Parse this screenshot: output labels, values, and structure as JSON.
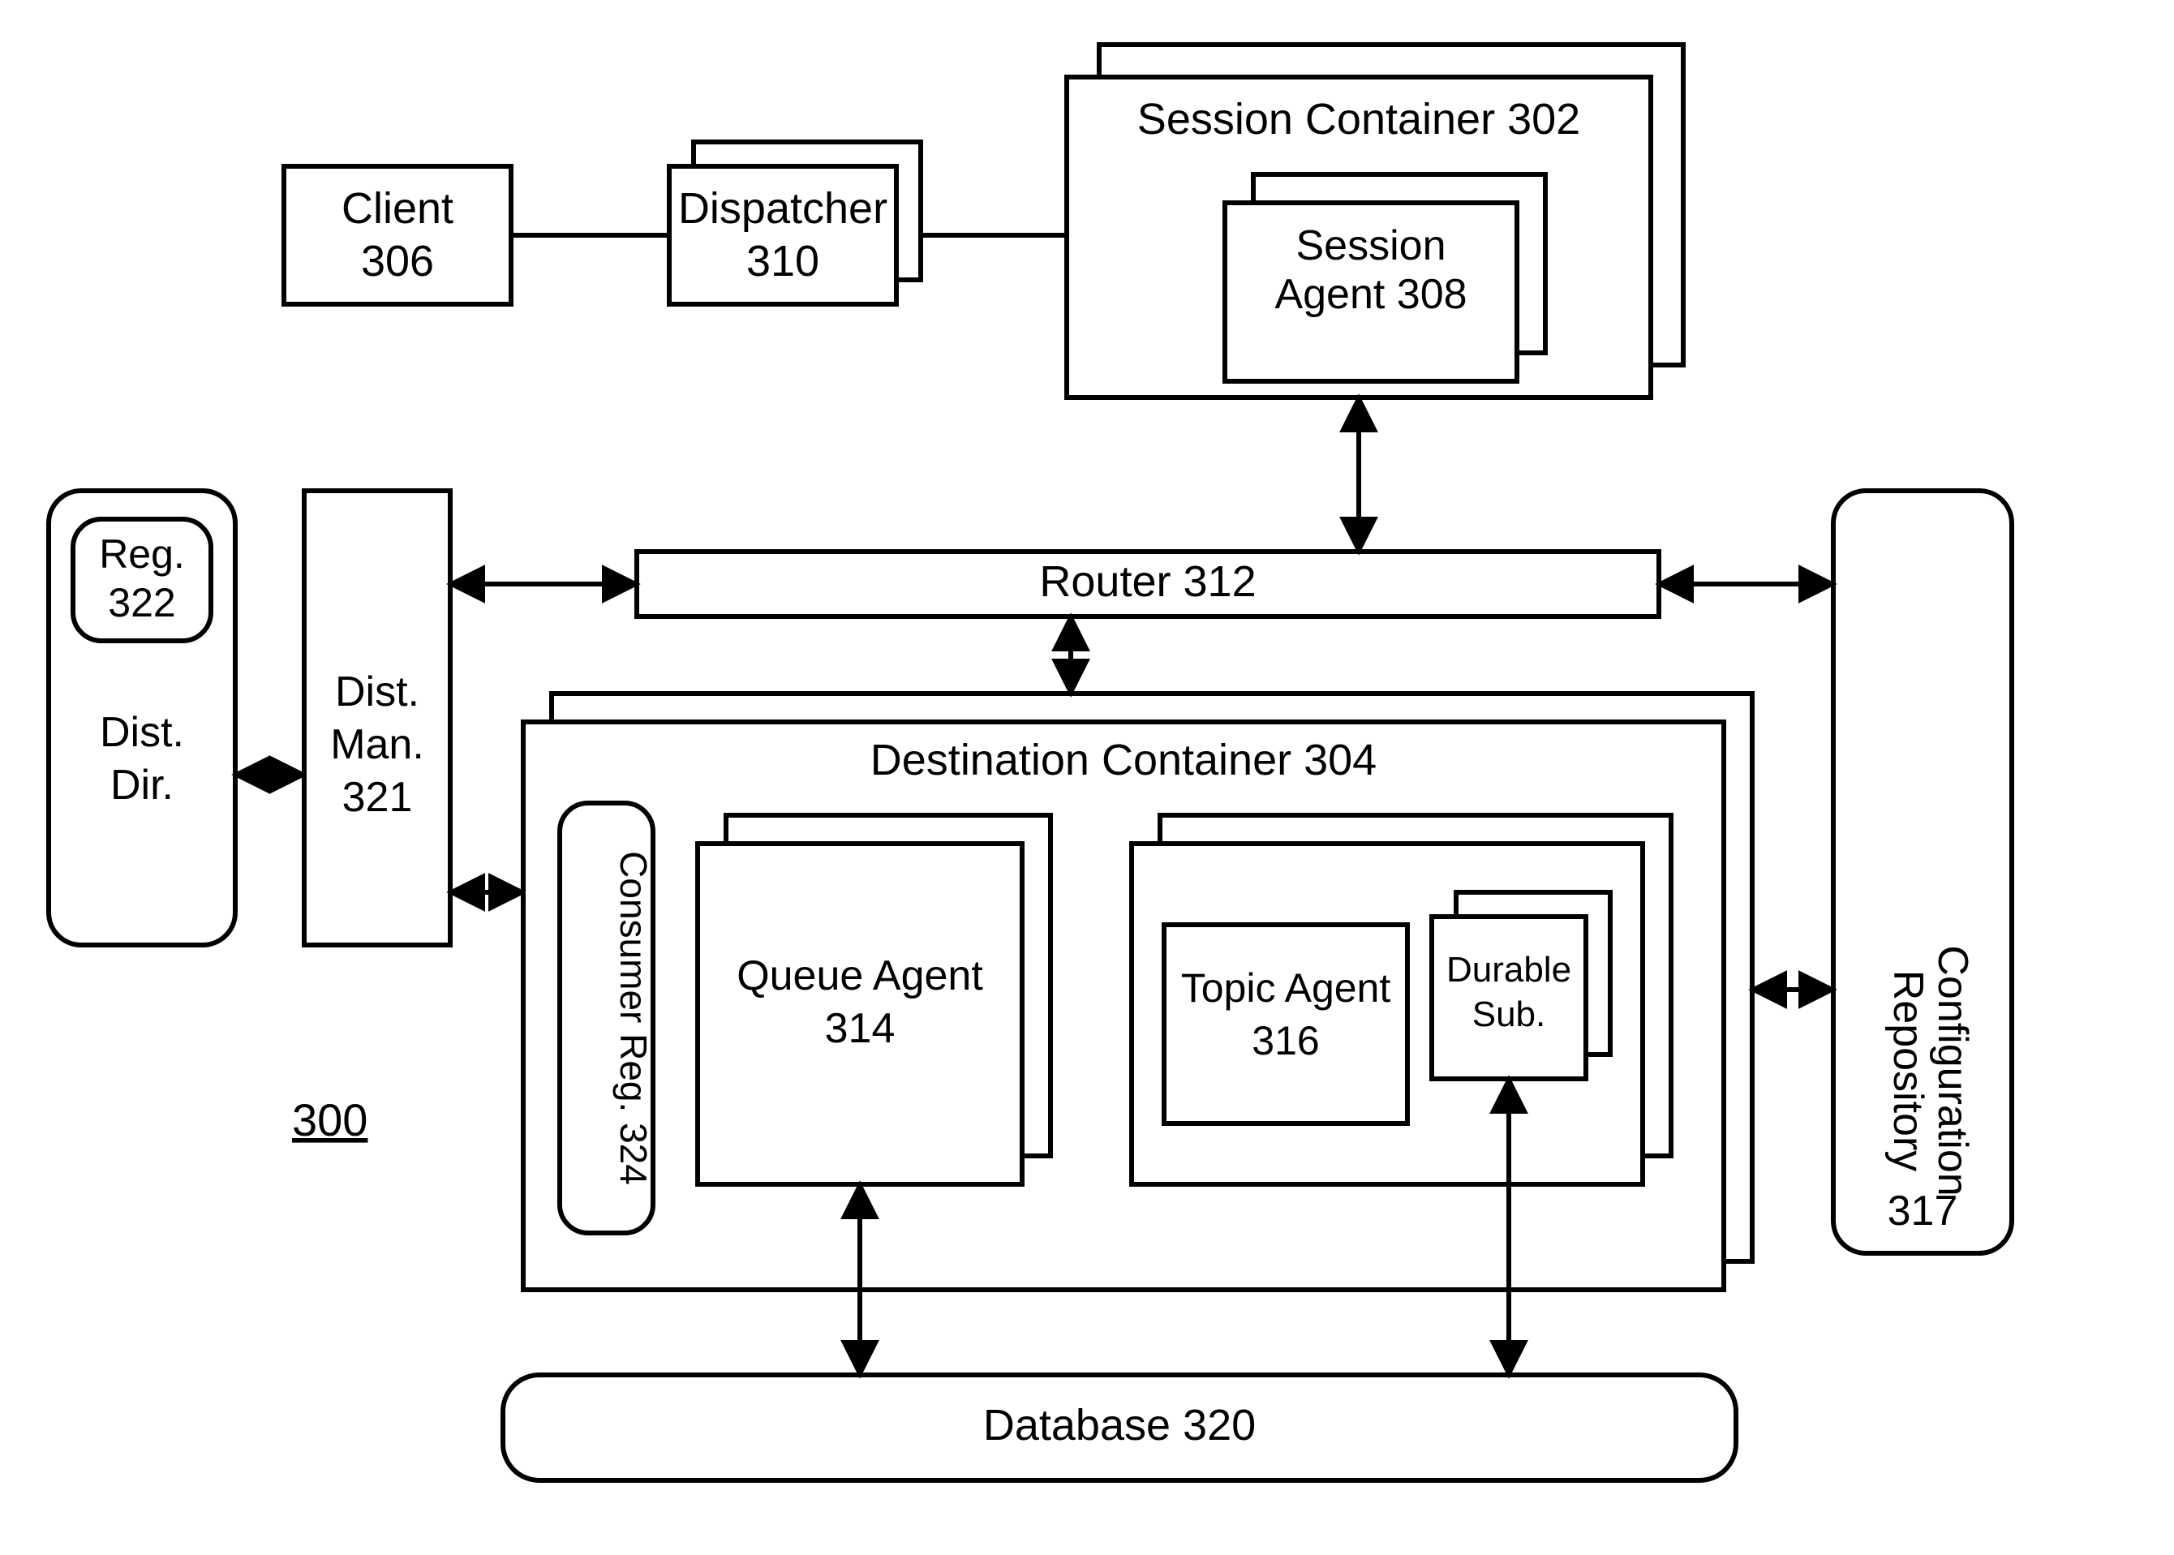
{
  "figure_ref": "300",
  "client": {
    "label": "Client",
    "num": "306"
  },
  "dispatcher": {
    "label": "Dispatcher",
    "num": "310"
  },
  "session_container": {
    "label": "Session Container",
    "num": "302"
  },
  "session_agent": {
    "line1": "Session",
    "line2": "Agent",
    "num": "308"
  },
  "router": {
    "label": "Router",
    "num": "312"
  },
  "dest_container": {
    "label": "Destination Container",
    "num": "304"
  },
  "queue_agent": {
    "label": "Queue Agent",
    "num": "314"
  },
  "topic_agent": {
    "label": "Topic Agent",
    "num": "316"
  },
  "durable_sub": {
    "line1": "Durable",
    "line2": "Sub."
  },
  "consumer_reg": {
    "label": "Consumer Reg.",
    "num": "324"
  },
  "dist_dir": {
    "line1": "Dist.",
    "line2": "Dir."
  },
  "reg": {
    "label": "Reg.",
    "num": "322"
  },
  "dist_man": {
    "line1": "Dist.",
    "line2": "Man.",
    "num": "321"
  },
  "config_repo": {
    "line1": "Configuration",
    "line2": "Repository",
    "num": "317"
  },
  "database": {
    "label": "Database",
    "num": "320"
  }
}
